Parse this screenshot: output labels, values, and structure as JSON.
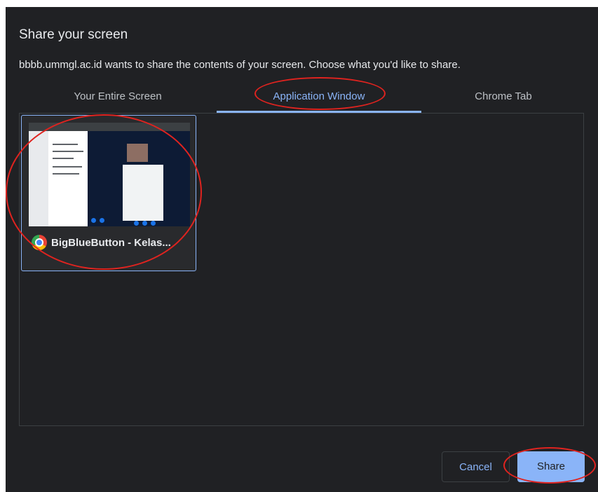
{
  "dialog": {
    "title": "Share your screen",
    "subtitle": "bbbb.ummgl.ac.id wants to share the contents of your screen. Choose what you'd like to share."
  },
  "tabs": [
    {
      "label": "Your Entire Screen",
      "active": false
    },
    {
      "label": "Application Window",
      "active": true
    },
    {
      "label": "Chrome Tab",
      "active": false
    }
  ],
  "windows": [
    {
      "title": "BigBlueButton - Kelas...",
      "icon": "chrome-icon",
      "selected": true
    }
  ],
  "actions": {
    "cancel_label": "Cancel",
    "share_label": "Share"
  },
  "colors": {
    "background": "#202124",
    "accent": "#8ab4f8",
    "annotation": "#e0231f"
  }
}
